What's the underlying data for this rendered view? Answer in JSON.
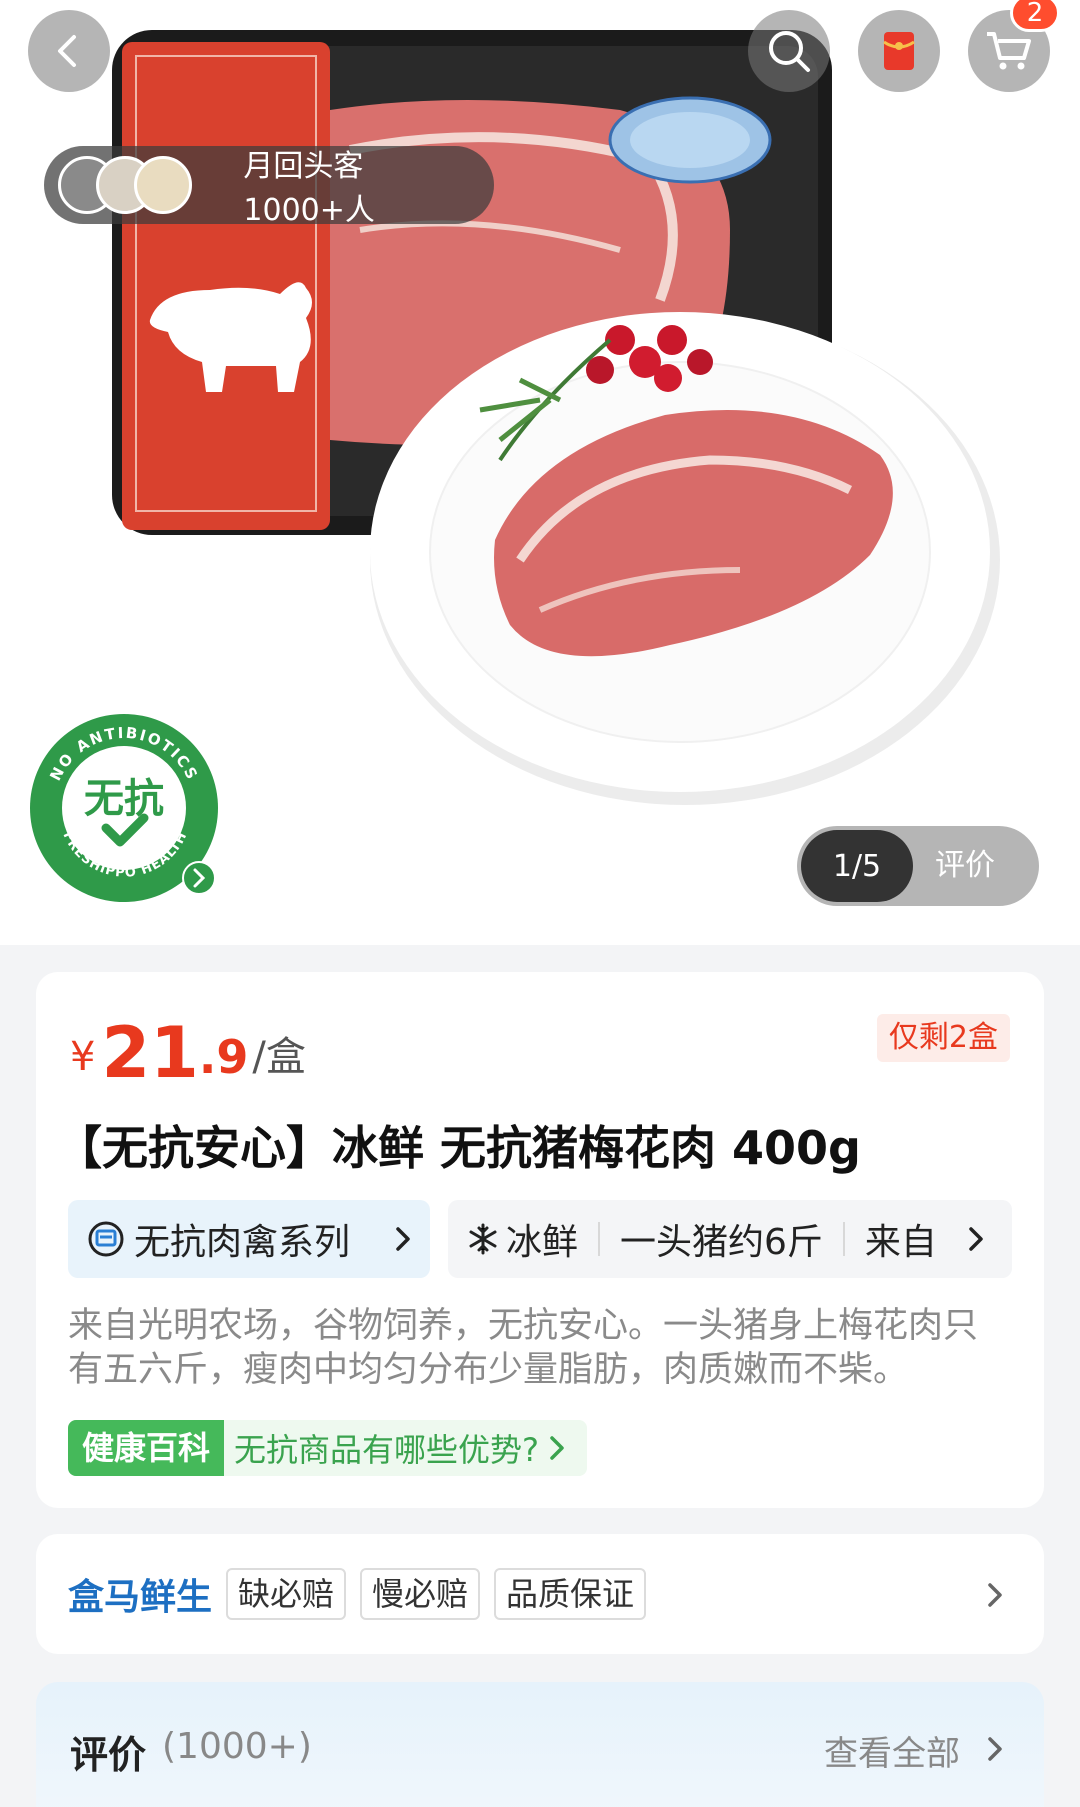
{
  "header": {
    "cart_count": "2"
  },
  "social": {
    "text": "月回头客1000+人"
  },
  "badge": {
    "cn": "无抗",
    "ring_top": "NO ANTIBIOTICS",
    "ring_bottom": "FRESHIPPO HEALTH"
  },
  "gallery": {
    "index": "1/5",
    "review_label": "评价"
  },
  "product": {
    "price_symbol": "¥",
    "price_int": "21",
    "price_dec": ".9",
    "price_unit": "/盒",
    "stock": "仅剩2盒",
    "title": "【无抗安心】冰鲜 无抗猪梅花肉 400g",
    "series_label": "无抗肉禽系列",
    "attributes": [
      "冰鲜",
      "一头猪约6斤",
      "来自"
    ],
    "description": "来自光明农场，谷物饲养，无抗安心。一头猪身上梅花肉只有五六斤，瘦肉中均匀分布少量脂肪，肉质嫩而不柴。",
    "wiki_tag": "健康百科",
    "wiki_text": "无抗商品有哪些优势?"
  },
  "guarantee": {
    "brand": "盒马鲜生",
    "tags": [
      "缺必赔",
      "慢必赔",
      "品质保证"
    ]
  },
  "reviews": {
    "title": "评价",
    "count": "(1000+)",
    "view_all": "查看全部"
  },
  "colors": {
    "price": "#e8391e",
    "brand_blue": "#1d6fc2",
    "wiki_green": "#45b95a"
  }
}
